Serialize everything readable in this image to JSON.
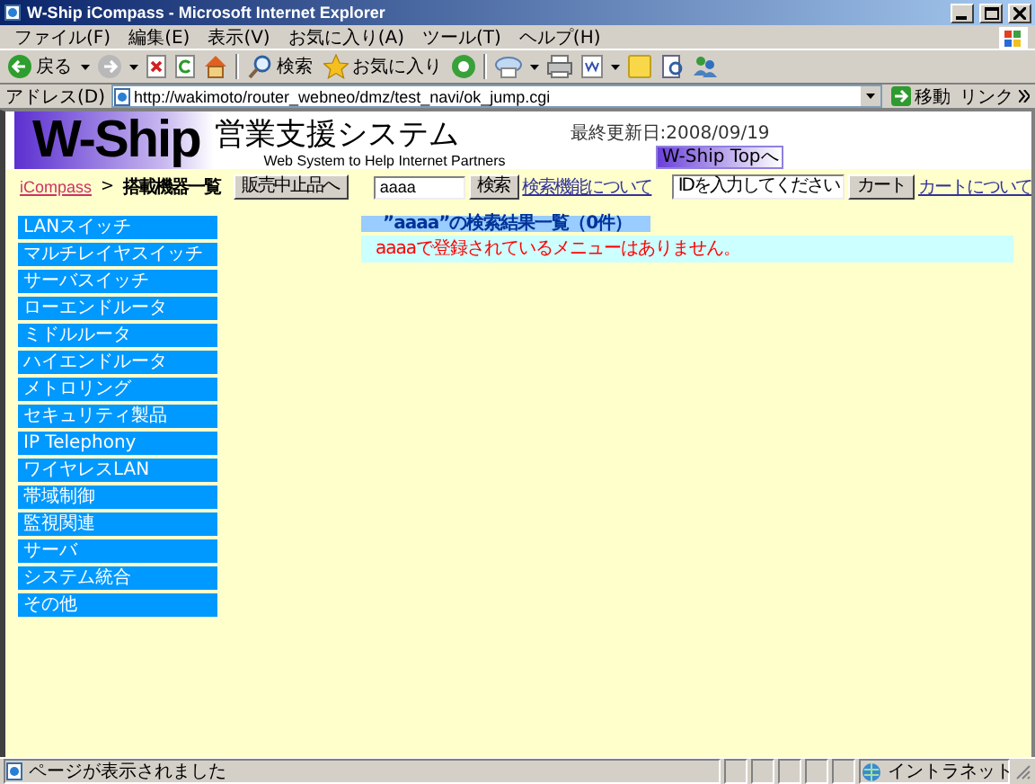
{
  "window": {
    "title": "W-Ship iCompass - Microsoft Internet Explorer"
  },
  "menu": [
    "ファイル(F)",
    "編集(E)",
    "表示(V)",
    "お気に入り(A)",
    "ツール(T)",
    "ヘルプ(H)"
  ],
  "toolbar": {
    "back": "戻る",
    "search": "検索",
    "favorites": "お気に入り"
  },
  "address": {
    "label": "アドレス(D)",
    "url": "http://wakimoto/router_webneo/dmz/test_navi/ok_jump.cgi",
    "go": "移動",
    "links": "リンク"
  },
  "header": {
    "logo": "W-Ship",
    "title": "営業支援システム",
    "subtitle": "Web System to Help Internet Partners",
    "updated": "最終更新日:2008/09/19",
    "top_button": "W-Ship Topへ"
  },
  "nav": {
    "breadcrumb_link": "iCompass",
    "separator": ">",
    "current": "搭載機器一覧",
    "discontinued_button": "販売中止品へ",
    "search_value": "aaaa",
    "search_button": "検索",
    "search_help": "検索機能について",
    "cart_placeholder": "IDを入力してください",
    "cart_button": "カート",
    "cart_help": "カートについて"
  },
  "sidebar": {
    "items": [
      "LANスイッチ",
      "マルチレイヤスイッチ",
      "サーバスイッチ",
      "ローエンドルータ",
      "ミドルルータ",
      "ハイエンドルータ",
      "メトロリング",
      "セキュリティ製品",
      "IP Telephony",
      "ワイヤレスLAN",
      "帯域制御",
      "監視関連",
      "サーバ",
      "システム統合",
      "その他"
    ]
  },
  "results": {
    "heading": "”aaaa”の検索結果一覧（0件）",
    "message": "aaaaで登録されているメニューはありません。"
  },
  "status_bar": {
    "text": "ページが表示されました",
    "zone": "イントラネット"
  }
}
